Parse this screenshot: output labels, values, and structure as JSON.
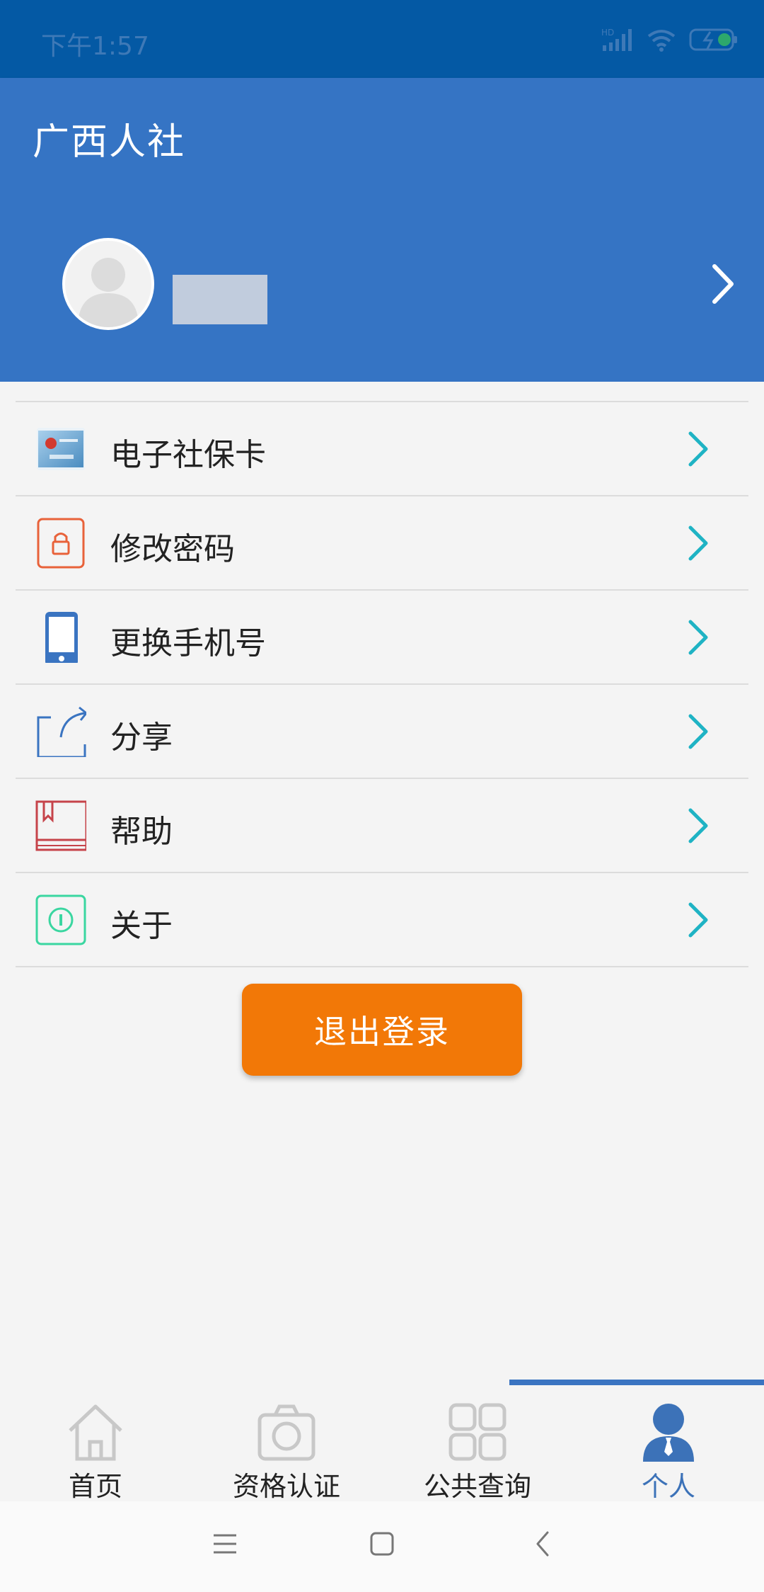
{
  "status_bar": {
    "time": "下午1:57",
    "network": "HD"
  },
  "app_title": "广西人社",
  "menu": [
    {
      "label": "电子社保卡",
      "icon": "social-security-card-icon"
    },
    {
      "label": "修改密码",
      "icon": "lock-icon"
    },
    {
      "label": "更换手机号",
      "icon": "mobile-phone-icon"
    },
    {
      "label": "分享",
      "icon": "share-icon"
    },
    {
      "label": "帮助",
      "icon": "book-icon"
    },
    {
      "label": "关于",
      "icon": "info-icon"
    }
  ],
  "logout_label": "退出登录",
  "tabs": [
    {
      "label": "首页",
      "icon": "home-icon",
      "active": false
    },
    {
      "label": "资格认证",
      "icon": "camera-icon",
      "active": false
    },
    {
      "label": "公共查询",
      "icon": "grid-icon",
      "active": false
    },
    {
      "label": "个人",
      "icon": "person-icon",
      "active": true
    }
  ],
  "colors": {
    "header": "#3574c4",
    "status_bar": "#0459a4",
    "accent_arrow": "#1fb3c4",
    "logout": "#f27807",
    "active_tab": "#3c72b8"
  }
}
